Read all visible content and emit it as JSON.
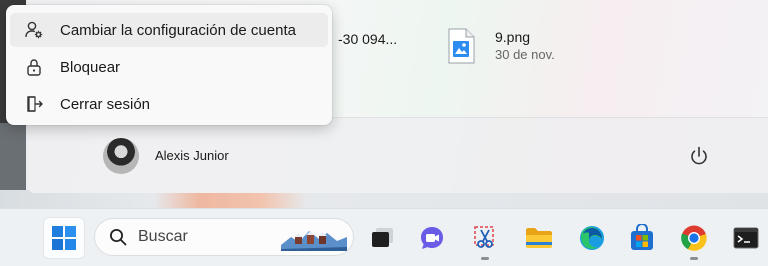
{
  "context_menu": {
    "items": [
      {
        "label": "Cambiar la configuración de cuenta",
        "icon": "account-settings-icon"
      },
      {
        "label": "Bloquear",
        "icon": "lock-icon"
      },
      {
        "label": "Cerrar sesión",
        "icon": "sign-out-icon"
      }
    ]
  },
  "recent_files": {
    "partial_name": "-30 094...",
    "item": {
      "name": "9.png",
      "date": "30 de nov.",
      "icon": "image-file-icon"
    }
  },
  "user": {
    "name": "Alexis Junior",
    "avatar": "user-avatar"
  },
  "power": {
    "icon": "power-icon"
  },
  "taskbar": {
    "search_placeholder": "Buscar",
    "apps": [
      {
        "name": "start",
        "icon": "windows-logo-icon"
      },
      {
        "name": "task-view",
        "icon": "task-view-icon"
      },
      {
        "name": "chat",
        "icon": "chat-icon"
      },
      {
        "name": "snipping-tool",
        "icon": "snipping-tool-icon"
      },
      {
        "name": "file-explorer",
        "icon": "folder-icon"
      },
      {
        "name": "edge",
        "icon": "edge-icon"
      },
      {
        "name": "store",
        "icon": "store-icon"
      },
      {
        "name": "chrome",
        "icon": "chrome-icon"
      },
      {
        "name": "terminal",
        "icon": "terminal-icon"
      }
    ]
  },
  "colors": {
    "accent_blue": "#0067c0",
    "menu_bg": "#f9f9f9",
    "taskbar_bg": "#eef1f4"
  }
}
